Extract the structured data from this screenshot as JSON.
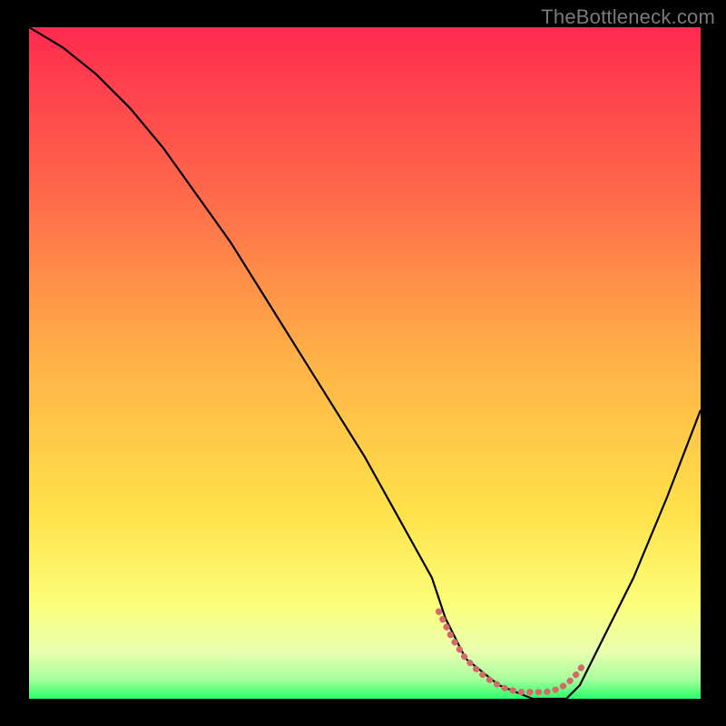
{
  "watermark": "TheBottleneck.com",
  "chart_data": {
    "type": "line",
    "title": "",
    "xlabel": "",
    "ylabel": "",
    "xlim": [
      0,
      100
    ],
    "ylim": [
      0,
      100
    ],
    "grid": false,
    "legend": false,
    "background_gradient_stops": [
      {
        "offset": 0.0,
        "color": "#ff2a4f"
      },
      {
        "offset": 0.25,
        "color": "#ff6a4a"
      },
      {
        "offset": 0.5,
        "color": "#ffb347"
      },
      {
        "offset": 0.72,
        "color": "#ffe14a"
      },
      {
        "offset": 0.86,
        "color": "#fcff7a"
      },
      {
        "offset": 0.93,
        "color": "#e9ffb0"
      },
      {
        "offset": 0.97,
        "color": "#a9ff9c"
      },
      {
        "offset": 1.0,
        "color": "#2bff6a"
      }
    ],
    "series": [
      {
        "name": "curve",
        "stroke": "#000000",
        "stroke_width": 2.2,
        "x": [
          0,
          5,
          10,
          15,
          20,
          25,
          30,
          35,
          40,
          45,
          50,
          55,
          60,
          62,
          65,
          70,
          75,
          80,
          82,
          85,
          90,
          95,
          100
        ],
        "y": [
          100,
          97,
          93,
          88,
          82,
          75,
          68,
          60,
          52,
          44,
          36,
          27,
          18,
          12,
          6,
          2,
          0,
          0,
          2,
          8,
          18,
          30,
          43
        ]
      },
      {
        "name": "valley-highlight",
        "stroke": "#d46a6a",
        "stroke_width": 7,
        "linecap": "round",
        "dash": "0.5 9",
        "x": [
          61,
          63,
          65,
          67,
          69,
          71,
          73,
          75,
          77,
          79,
          81,
          82.5
        ],
        "y": [
          13,
          9,
          6,
          4,
          2.5,
          1.5,
          1,
          1,
          1,
          1.5,
          3,
          5
        ]
      }
    ]
  }
}
